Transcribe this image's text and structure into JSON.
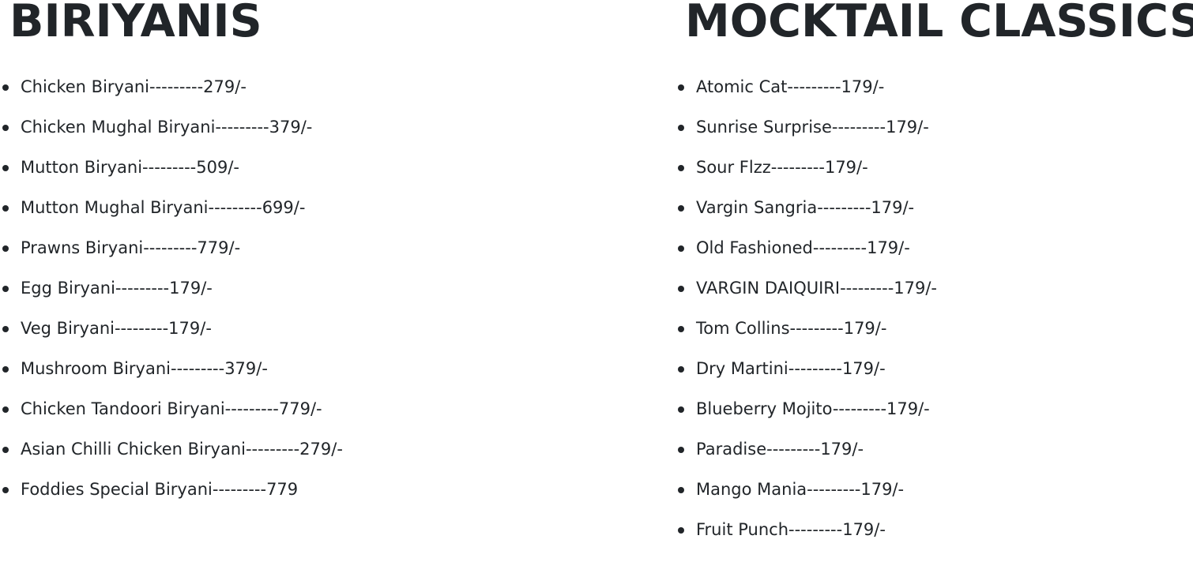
{
  "sections": [
    {
      "title": "BIRIYANIS",
      "items": [
        {
          "text": "Chicken Biryani---------279/-"
        },
        {
          "text": "Chicken Mughal Biryani---------379/-"
        },
        {
          "text": "Mutton Biryani---------509/-"
        },
        {
          "text": "Mutton Mughal Biryani---------699/-"
        },
        {
          "text": "Prawns Biryani---------779/-"
        },
        {
          "text": "Egg Biryani---------179/-"
        },
        {
          "text": "Veg Biryani---------179/-"
        },
        {
          "text": "Mushroom Biryani---------379/-"
        },
        {
          "text": "Chicken Tandoori Biryani---------779/-"
        },
        {
          "text": "Asian Chilli Chicken Biryani---------279/-"
        },
        {
          "text": "Foddies Special Biryani---------779"
        }
      ]
    },
    {
      "title": "MOCKTAIL CLASSICS",
      "items": [
        {
          "text": "Atomic Cat---------179/-"
        },
        {
          "text": "Sunrise Surprise---------179/-"
        },
        {
          "text": "Sour Flzz---------179/-"
        },
        {
          "text": "Vargin Sangria---------179/-"
        },
        {
          "text": "Old Fashioned---------179/-"
        },
        {
          "text": "VARGIN DAIQUIRI---------179/-"
        },
        {
          "text": "Tom Collins---------179/-"
        },
        {
          "text": "Dry Martini---------179/-"
        },
        {
          "text": "Blueberry Mojito---------179/-"
        },
        {
          "text": "Paradise---------179/-"
        },
        {
          "text": "Mango Mania---------179/-"
        },
        {
          "text": "Fruit Punch---------179/-"
        }
      ]
    }
  ]
}
